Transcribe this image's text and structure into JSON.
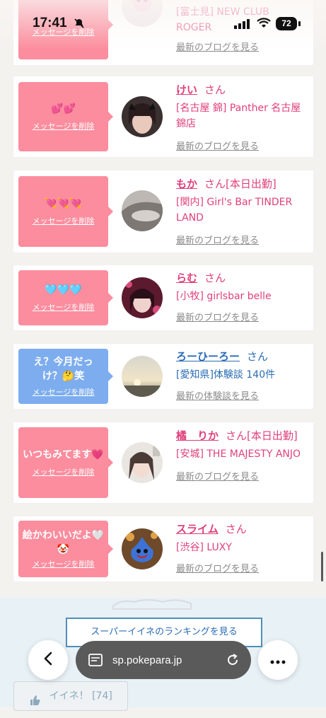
{
  "status_bar": {
    "time": "17:41",
    "battery": "72"
  },
  "messages": [
    {
      "bubble_text": "",
      "delete_label": "メッセージを削除",
      "name": "",
      "san": "",
      "tag": "",
      "shop": "[富士見] NEW CLUB ROGER",
      "blog_link": "最新のブログを見る",
      "color": "pink"
    },
    {
      "bubble_text": "💕💕",
      "delete_label": "メッセージを削除",
      "name": "けい",
      "san": "さん",
      "tag": "",
      "shop": "[名古屋 錦] Panther 名古屋錦店",
      "blog_link": "最新のブログを見る",
      "color": "pink"
    },
    {
      "bubble_text": "💘💘💘",
      "delete_label": "メッセージを削除",
      "name": "もか",
      "san": "さん",
      "tag": "[本日出勤]",
      "shop": "[関内] Girl's Bar TINDER LAND",
      "blog_link": "最新のブログを見る",
      "color": "pink"
    },
    {
      "bubble_text": "🩵🩵🩵",
      "delete_label": "メッセージを削除",
      "name": "らむ",
      "san": "さん",
      "tag": "",
      "shop": "[小牧] girlsbar belle",
      "blog_link": "最新のブログを見る",
      "color": "pink"
    },
    {
      "bubble_text": "え？今月だっけ？🤔笑",
      "delete_label": "メッセージを削除",
      "name": "ろーひーろー",
      "san": "さん",
      "tag": "",
      "shop": "[愛知県]体験談 140件",
      "blog_link": "最新の体験談を見る",
      "color": "blue"
    },
    {
      "bubble_text": "いつもみてます💗",
      "delete_label": "メッセージを削除",
      "name": "橘　りか",
      "san": "さん",
      "tag": "[本日出勤]",
      "shop": "[安城] THE MAJESTY ANJO",
      "blog_link": "最新のブログを見る",
      "color": "pink"
    },
    {
      "bubble_text": "絵かわいいだよ🤍🤡",
      "delete_label": "メッセージを削除",
      "name": "スライム",
      "san": "さん",
      "tag": "",
      "shop": "[渋谷] LUXY",
      "blog_link": "最新のブログを見る",
      "color": "pink"
    }
  ],
  "ranking_button": "スーパーイイネのランキングを見る",
  "like_button": "イイネ！ [74]",
  "browser": {
    "url": "sp.pokepara.jp"
  },
  "colors": {
    "pink_bubble": "#fb8d9e",
    "blue_bubble": "#7dadee",
    "name_pink": "#e0407a",
    "name_blue": "#2a6cb5"
  }
}
